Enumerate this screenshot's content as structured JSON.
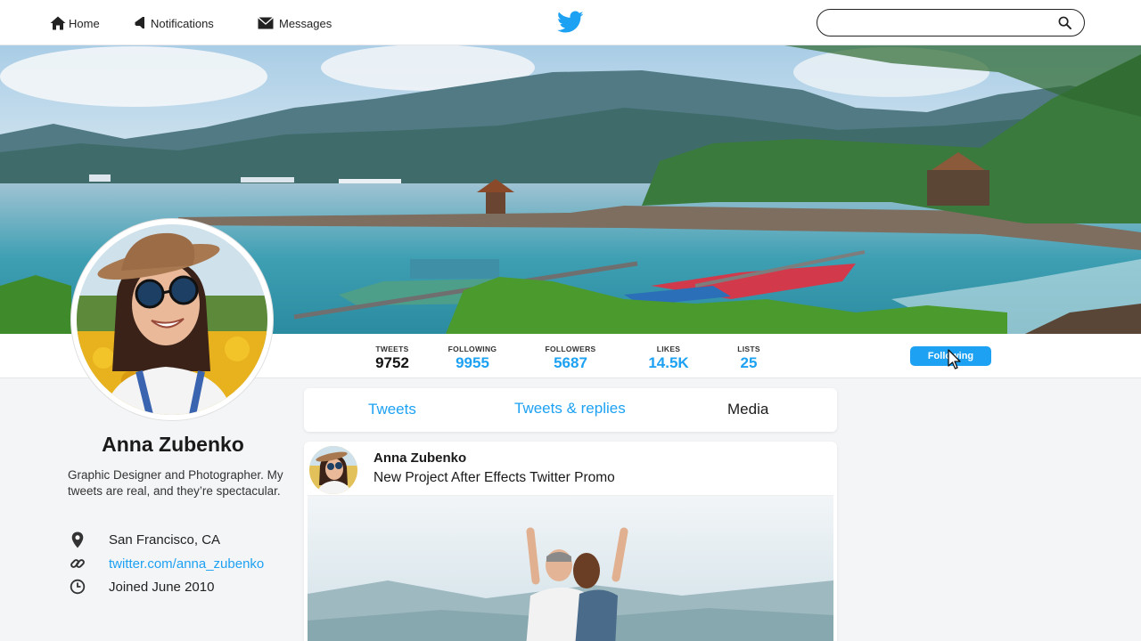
{
  "nav": {
    "home": "Home",
    "notifications": "Notifications",
    "messages": "Messages",
    "search_value": "",
    "search_placeholder": ""
  },
  "stats": {
    "tweets": {
      "label": "TWEETS",
      "value": "9752"
    },
    "following": {
      "label": "FOLLOWING",
      "value": "9955"
    },
    "followers": {
      "label": "FOLLOWERS",
      "value": "5687"
    },
    "likes": {
      "label": "LIKES",
      "value": "14.5K"
    },
    "lists": {
      "label": "LISTS",
      "value": "25"
    },
    "follow_button": "Following"
  },
  "profile": {
    "name": "Anna Zubenko",
    "bio": "Graphic Designer and Photographer. My tweets are real, and they’re spectacular.",
    "location": "San Francisco, CA",
    "website": "twitter.com/anna_zubenko",
    "joined": "Joined June 2010"
  },
  "tabs": {
    "tweets": "Tweets",
    "replies": "Tweets & replies",
    "media": "Media"
  },
  "tweet": {
    "author": "Anna Zubenko",
    "text": "New Project After Effects Twitter Promo"
  },
  "colors": {
    "accent": "#1da1f2",
    "text": "#1c1c1c",
    "background": "#f4f5f7"
  },
  "icons": {
    "home": "home-icon",
    "notifications": "bell-icon",
    "messages": "envelope-icon",
    "brand": "twitter-bird-icon",
    "search": "search-icon",
    "location": "map-pin-icon",
    "website": "link-icon",
    "joined": "clock-icon"
  }
}
